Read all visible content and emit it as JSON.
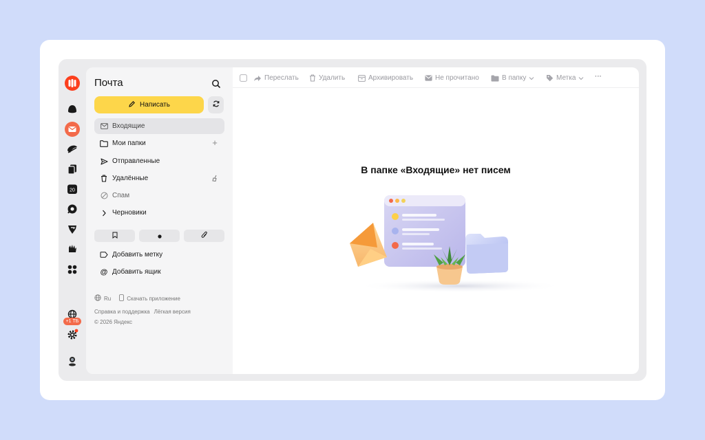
{
  "app": {
    "title": "Почта",
    "accent": "#fc3f1d",
    "compose_color": "#fdd64a"
  },
  "sidebar": {
    "compose_label": "Написать",
    "folders": [
      {
        "label": "Входящие",
        "icon": "envelope-icon",
        "active": true
      },
      {
        "label": "Мои папки",
        "icon": "folder-icon",
        "trail": "+"
      },
      {
        "label": "Отправленные",
        "icon": "send-icon"
      },
      {
        "label": "Удалённые",
        "icon": "trash-icon",
        "trail_icon": "broom-icon"
      },
      {
        "label": "Спам",
        "icon": "spam-icon"
      },
      {
        "label": "Черновики",
        "icon": "chevron-right-icon"
      }
    ],
    "quick_filters": [
      "bookmark-icon",
      "unread-dot-icon",
      "attachment-icon"
    ],
    "add_label": "Добавить метку",
    "add_mailbox": "Добавить ящик"
  },
  "rail": {
    "storage_badge": "+1 ТБ",
    "calendar_day": "20"
  },
  "footer": {
    "language": "Ru",
    "download_app": "Скачать приложение",
    "help": "Справка и поддержка",
    "lite": "Лёгкая версия",
    "copyright": "© 2026 Яндекс"
  },
  "toolbar": {
    "forward": "Переслать",
    "delete": "Удалить",
    "archive": "Архивировать",
    "unread": "Не прочитано",
    "to_folder": "В папку",
    "label": "Метка",
    "more": "···"
  },
  "main": {
    "empty_title": "В папке «Входящие» нет писем"
  }
}
